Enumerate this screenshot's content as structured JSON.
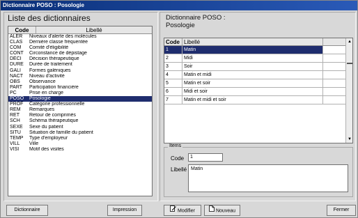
{
  "window": {
    "title": "Dictionnaire POSO : Posologie"
  },
  "left": {
    "title": "Liste des dictionnaires",
    "columns": {
      "code": "Code",
      "label": "Libellé"
    },
    "rows": [
      {
        "code": "ALER",
        "label": "Niveaux d'alerte des molécules"
      },
      {
        "code": "CLAS",
        "label": "Dernière classe fréquentée"
      },
      {
        "code": "COM",
        "label": "Comité d'éligibilité"
      },
      {
        "code": "CONT",
        "label": "Circonstance de dépistage"
      },
      {
        "code": "DECI",
        "label": "Décision thérapeutique"
      },
      {
        "code": "DURE",
        "label": "Durée de traitement"
      },
      {
        "code": "GALI",
        "label": "Formes galéniques"
      },
      {
        "code": "NACT",
        "label": "Niveau d'activité"
      },
      {
        "code": "OBS",
        "label": "Observance"
      },
      {
        "code": "PART",
        "label": "Participation financière"
      },
      {
        "code": "PC",
        "label": "Prise en charge"
      },
      {
        "code": "POSO",
        "label": "Posologie",
        "selected": true
      },
      {
        "code": "PROF",
        "label": "Catégorie professionnelle"
      },
      {
        "code": "REM",
        "label": "Remarques"
      },
      {
        "code": "RET",
        "label": "Retour de comprimés"
      },
      {
        "code": "SCH",
        "label": "Schéma thérapeutique"
      },
      {
        "code": "SEXE",
        "label": "Sexe du patient"
      },
      {
        "code": "SITU",
        "label": "Situation de famille du patient"
      },
      {
        "code": "TEMP",
        "label": "Type d'employeur"
      },
      {
        "code": "VILL",
        "label": "Ville"
      },
      {
        "code": "VISI",
        "label": "Motif des visites"
      }
    ]
  },
  "right": {
    "title_line1": "Dictionnaire POSO :",
    "title_line2": "Posologie",
    "columns": {
      "code": "Code",
      "label": "Libellé"
    },
    "rows": [
      {
        "code": "1",
        "label": "Matin",
        "selected": true
      },
      {
        "code": "2",
        "label": "Midi"
      },
      {
        "code": "3",
        "label": "Soir"
      },
      {
        "code": "4",
        "label": "Matin et midi"
      },
      {
        "code": "5",
        "label": "Matin et soir"
      },
      {
        "code": "6",
        "label": "Midi et soir"
      },
      {
        "code": "7",
        "label": "Matin et midi et soir"
      }
    ],
    "items": {
      "legend": "Items",
      "code_label": "Code",
      "code_value": "1",
      "label_label": "Libellé",
      "label_value": "Matin"
    }
  },
  "buttons": {
    "dictionary": "Dictionnaire",
    "print": "Impression",
    "modify": "Modifier",
    "new": "Nouveau",
    "close": "Fermer"
  },
  "icons": {
    "modify": "edit-document-icon",
    "new": "new-document-icon"
  },
  "colors": {
    "selection": "#1f2d6e",
    "titlebar": "#0a2f78"
  }
}
